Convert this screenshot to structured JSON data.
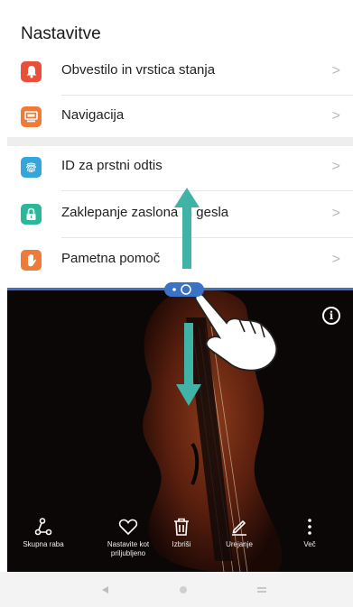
{
  "header": {
    "title": "Nastavitve"
  },
  "settings": {
    "group1": [
      {
        "label": "Obvestilo in vrstica stanja",
        "icon": "notification-bell-icon",
        "color": "#e8503a"
      },
      {
        "label": "Navigacija",
        "icon": "navigation-icon",
        "color": "#ef7b3a"
      }
    ],
    "group2": [
      {
        "label": "ID za prstni odtis",
        "icon": "fingerprint-icon",
        "color": "#35a6dc"
      },
      {
        "label": "Zaklepanje zaslona in gesla",
        "icon": "lock-icon",
        "color": "#2db79a"
      },
      {
        "label": "Pametna pomoč",
        "icon": "hand-icon",
        "color": "#ef7b3a"
      }
    ]
  },
  "toolbar": {
    "share": "Skupna raba",
    "favorite": "Nastavite kot priljubljeno",
    "delete": "Izbriši",
    "edit": "Urejanje",
    "more": "Več"
  },
  "info_icon": "i",
  "colors": {
    "accent": "#3a72c6",
    "gesture_arrow": "#3fb3a5"
  }
}
